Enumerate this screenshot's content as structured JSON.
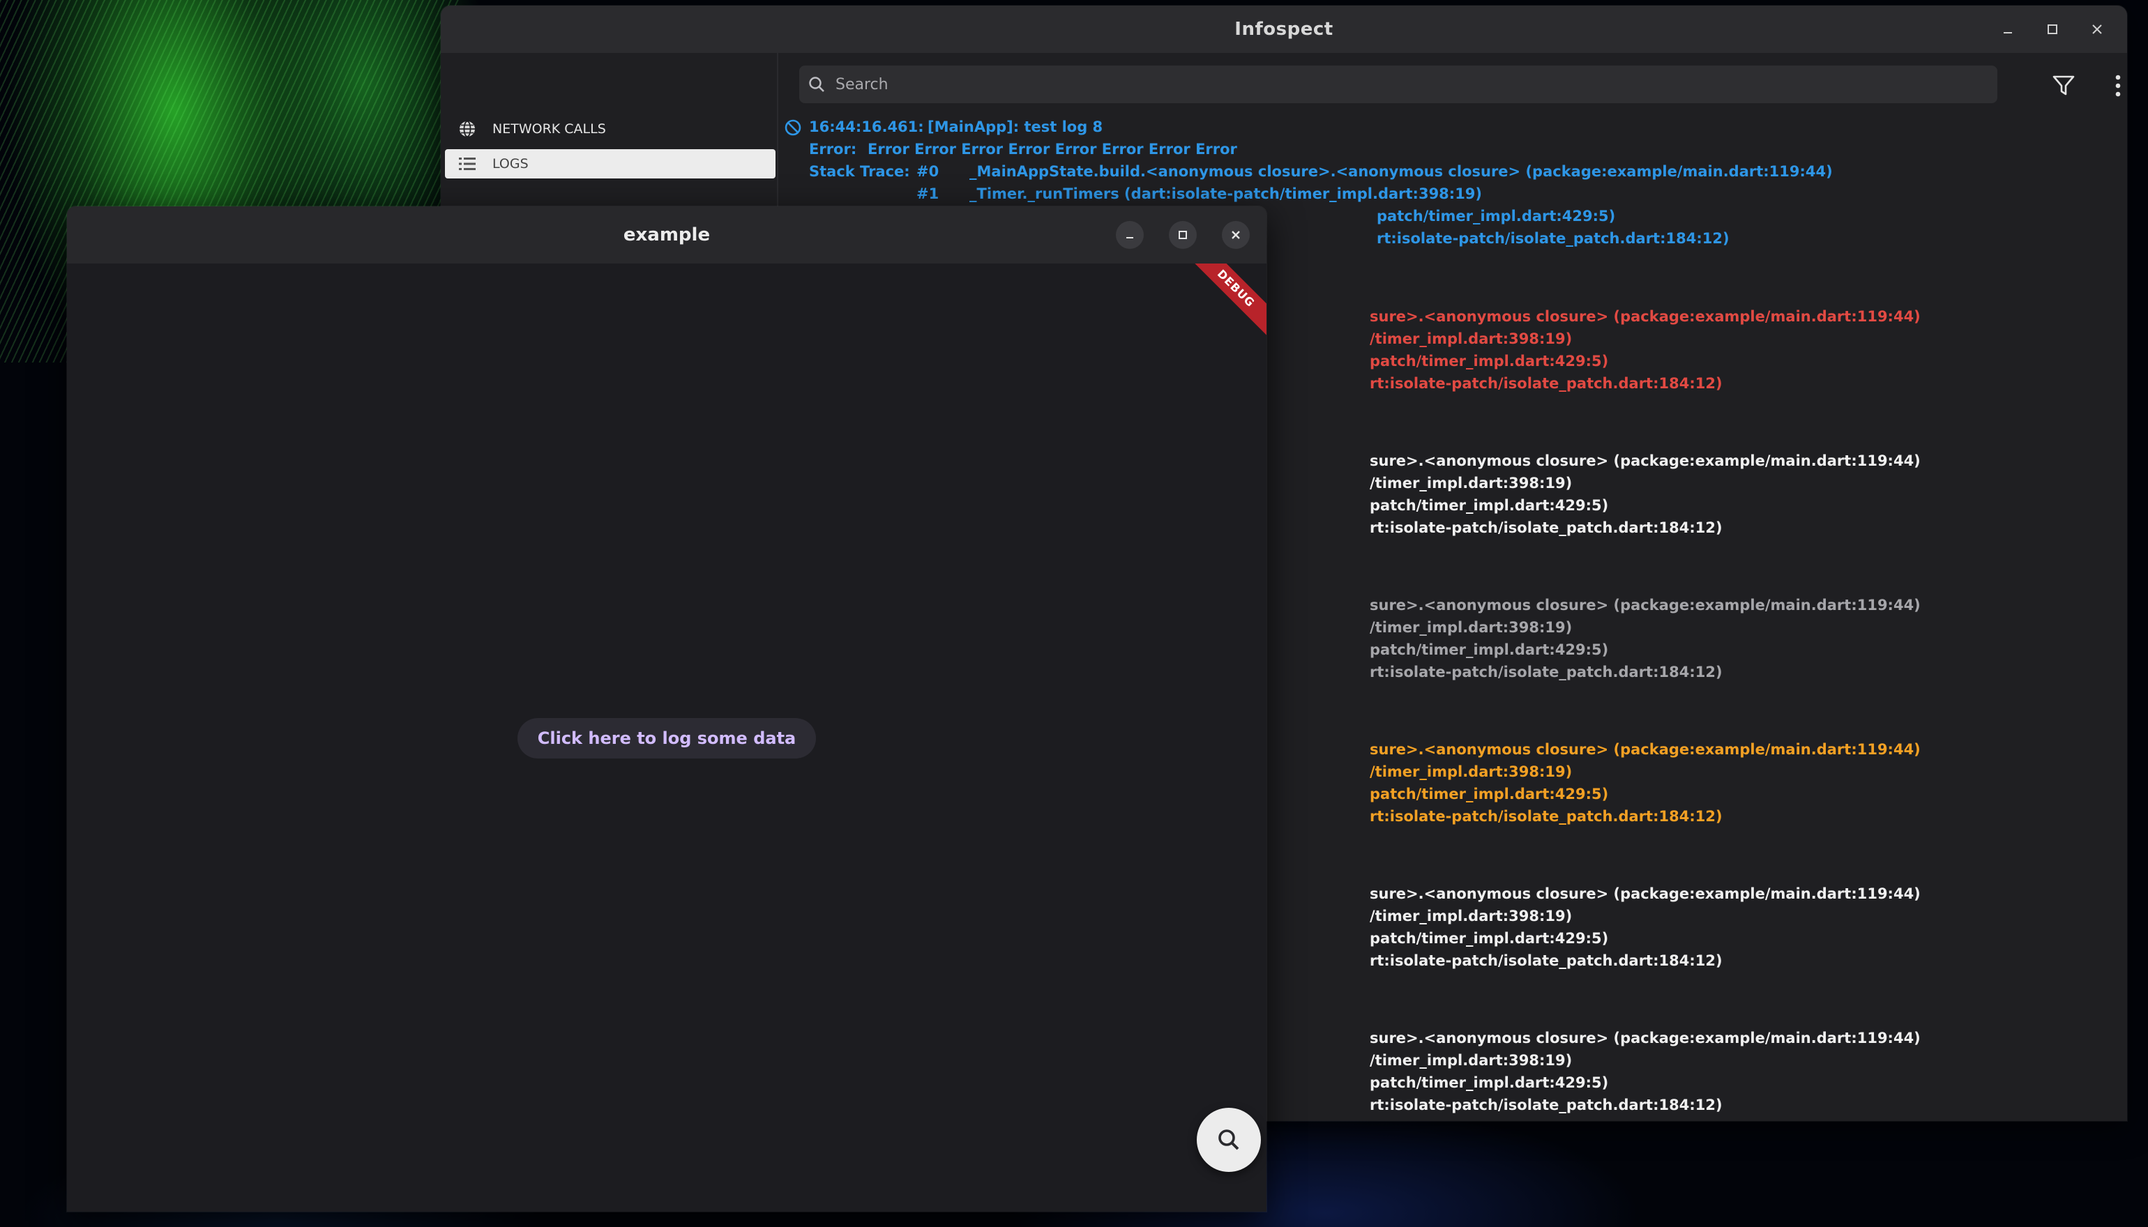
{
  "infospect": {
    "title": "Infospect",
    "sidebar": [
      {
        "label": "NETWORK CALLS",
        "icon": "globe-icon"
      },
      {
        "label": "LOGS",
        "icon": "list-icon"
      }
    ],
    "search_placeholder": "Search",
    "log_header": {
      "time": "16:44:16.461:",
      "tag": "[MainApp]: test log 8",
      "error_label": "Error:",
      "error_text": "Error Error Error Error Error Error Error Error",
      "stack_label": "Stack Trace:",
      "frame0_index": "#0",
      "frame0_text": "_MainAppState.build.<anonymous closure>.<anonymous closure> (package:example/main.dart:119:44)",
      "frame1_index": "#1",
      "frame1_text": "_Timer._runTimers (dart:isolate-patch/timer_impl.dart:398:19)",
      "frame2_tail": "patch/timer_impl.dart:429:5)",
      "frame3_tail": "rt:isolate-patch/isolate_patch.dart:184:12)"
    },
    "visible_fragments": [
      {
        "color": "#e24a43",
        "l1": "sure>.<anonymous closure> (package:example/main.dart:119:44)",
        "l2": "/timer_impl.dart:398:19)",
        "l3": "patch/timer_impl.dart:429:5)",
        "l4": "rt:isolate-patch/isolate_patch.dart:184:12)"
      },
      {
        "color": "#f0f0f0",
        "l1": "sure>.<anonymous closure> (package:example/main.dart:119:44)",
        "l2": "/timer_impl.dart:398:19)",
        "l3": "patch/timer_impl.dart:429:5)",
        "l4": "rt:isolate-patch/isolate_patch.dart:184:12)"
      },
      {
        "color": "#a6a6aa",
        "l1": "sure>.<anonymous closure> (package:example/main.dart:119:44)",
        "l2": "/timer_impl.dart:398:19)",
        "l3": "patch/timer_impl.dart:429:5)",
        "l4": "rt:isolate-patch/isolate_patch.dart:184:12)"
      },
      {
        "color": "#f2a024",
        "l1": "sure>.<anonymous closure> (package:example/main.dart:119:44)",
        "l2": "/timer_impl.dart:398:19)",
        "l3": "patch/timer_impl.dart:429:5)",
        "l4": "rt:isolate-patch/isolate_patch.dart:184:12)"
      },
      {
        "color": "#f0f0f0",
        "l1": "sure>.<anonymous closure> (package:example/main.dart:119:44)",
        "l2": "/timer_impl.dart:398:19)",
        "l3": "patch/timer_impl.dart:429:5)",
        "l4": "rt:isolate-patch/isolate_patch.dart:184:12)"
      },
      {
        "color": "#f0f0f0",
        "l1": "sure>.<anonymous closure> (package:example/main.dart:119:44)",
        "l2": "/timer_impl.dart:398:19)",
        "l3": "patch/timer_impl.dart:429:5)",
        "l4": "rt:isolate-patch/isolate_patch.dart:184:12)"
      }
    ],
    "colors": {
      "info": "#2e96e6",
      "error": "#e24a43",
      "plain": "#f0f0f0",
      "muted": "#a6a6aa",
      "warning": "#f2a024"
    }
  },
  "example": {
    "title": "example",
    "debug_banner": "DEBUG",
    "log_button": "Click here to log some data",
    "fab_icon": "search-icon"
  }
}
